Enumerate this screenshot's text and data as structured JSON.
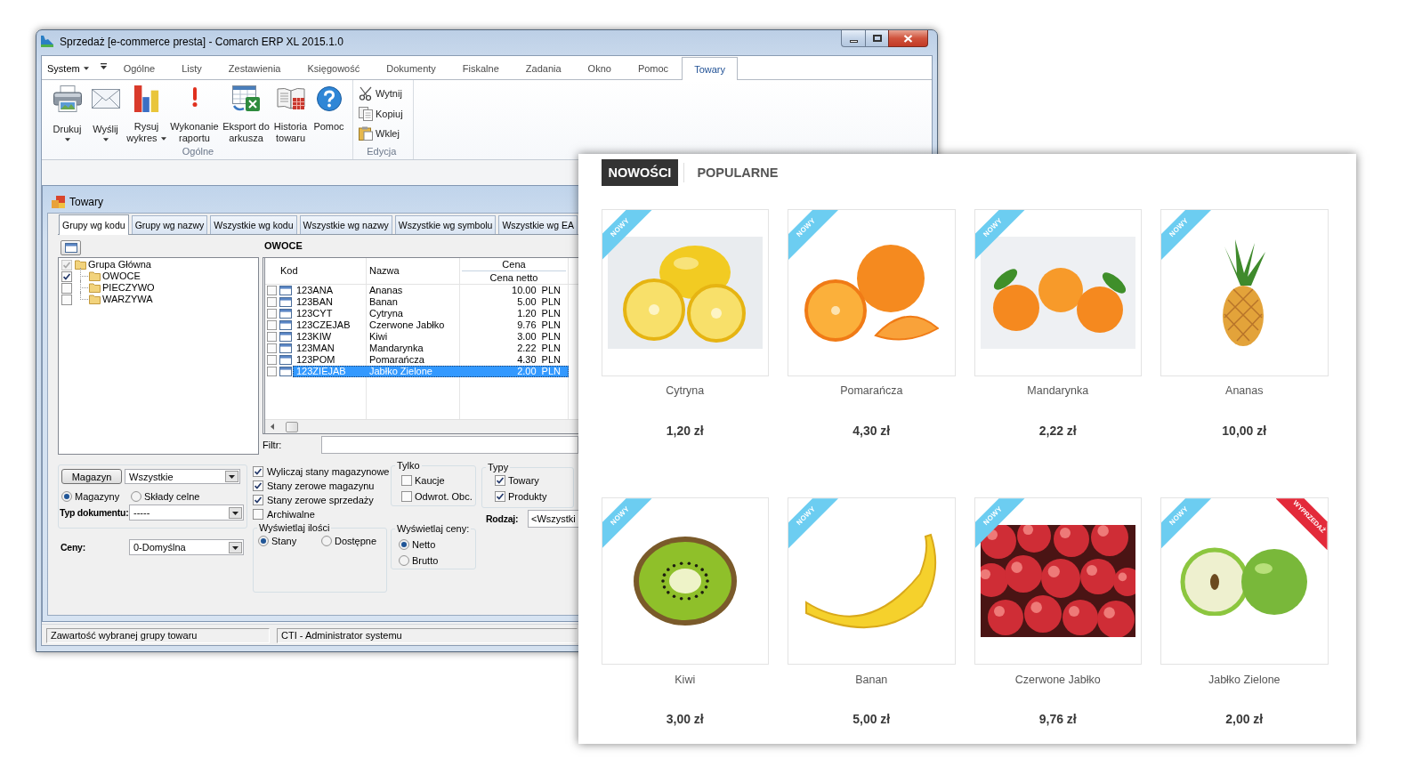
{
  "erp_window": {
    "title": "Sprzedaż [e-commerce presta] - Comarch ERP XL 2015.1.0",
    "menu": {
      "system": "System",
      "tabs": [
        {
          "label": "Ogólne",
          "selected": false
        },
        {
          "label": "Listy",
          "selected": false
        },
        {
          "label": "Zestawienia",
          "selected": false
        },
        {
          "label": "Księgowość",
          "selected": false
        },
        {
          "label": "Dokumenty",
          "selected": false
        },
        {
          "label": "Fiskalne",
          "selected": false
        },
        {
          "label": "Zadania",
          "selected": false
        },
        {
          "label": "Okno",
          "selected": false
        },
        {
          "label": "Pomoc",
          "selected": false
        },
        {
          "label": "Towary",
          "selected": true
        }
      ]
    },
    "ribbon": {
      "groups": [
        {
          "label": "Ogólne",
          "kind": "large",
          "buttons": [
            {
              "label": "Drukuj",
              "kind": "split"
            },
            {
              "label": "Wyślij",
              "kind": "split"
            },
            {
              "label": "Rysuj wykres",
              "kind": "menu"
            },
            {
              "label": "Wykonanie raportu",
              "kind": "plain"
            },
            {
              "label": "Eksport do arkusza",
              "kind": "plain"
            },
            {
              "label": "Historia towaru",
              "kind": "plain"
            },
            {
              "label": "Pomoc",
              "kind": "plain"
            }
          ]
        },
        {
          "label": "Edycja",
          "kind": "small",
          "buttons": [
            {
              "label": "Wytnij"
            },
            {
              "label": "Kopiuj"
            },
            {
              "label": "Wklej"
            }
          ]
        }
      ]
    },
    "child_window": {
      "title": "Towary",
      "tabs": [
        {
          "label": "Grupy wg kodu",
          "selected": true
        },
        {
          "label": "Grupy wg nazwy",
          "selected": false
        },
        {
          "label": "Wszystkie wg kodu",
          "selected": false
        },
        {
          "label": "Wszystkie wg nazwy",
          "selected": false
        },
        {
          "label": "Wszystkie wg symbolu",
          "selected": false
        },
        {
          "label": "Wszystkie wg EA",
          "selected": false
        }
      ],
      "tree": [
        {
          "label": "Grupa Główna",
          "checked": true,
          "disabled": true,
          "children": [
            {
              "label": "OWOCE",
              "checked": true,
              "disabled": false
            },
            {
              "label": "PIECZYWO",
              "checked": false,
              "disabled": false
            },
            {
              "label": "WARZYWA",
              "checked": false,
              "disabled": false
            }
          ]
        }
      ],
      "group_title": "OWOCE",
      "table": {
        "columns": [
          {
            "label": "Kod"
          },
          {
            "label": "Nazwa"
          },
          {
            "label": "Cena",
            "sublabel": "Cena netto"
          }
        ],
        "rows": [
          {
            "cells": [
              "123ANA",
              "Ananas",
              "10.00 PLN"
            ],
            "checked": false,
            "selected": false
          },
          {
            "cells": [
              "123BAN",
              "Banan",
              "5.00 PLN"
            ],
            "checked": false,
            "selected": false
          },
          {
            "cells": [
              "123CYT",
              "Cytryna",
              "1.20 PLN"
            ],
            "checked": false,
            "selected": false
          },
          {
            "cells": [
              "123CZEJAB",
              "Czerwone Jabłko",
              "9.76 PLN"
            ],
            "checked": false,
            "selected": false
          },
          {
            "cells": [
              "123KIW",
              "Kiwi",
              "3.00 PLN"
            ],
            "checked": false,
            "selected": false
          },
          {
            "cells": [
              "123MAN",
              "Mandarynka",
              "2.22 PLN"
            ],
            "checked": false,
            "selected": false
          },
          {
            "cells": [
              "123POM",
              "Pomarańcza",
              "4.30 PLN"
            ],
            "checked": false,
            "selected": false
          },
          {
            "cells": [
              "123ZIEJAB",
              "Jabłko Zielone",
              "2.00 PLN"
            ],
            "checked": false,
            "selected": true
          }
        ]
      },
      "filter": {
        "label": "Filtr:"
      },
      "options": {
        "magazyn": {
          "button": "Magazyn",
          "value": "Wszystkie"
        },
        "source": [
          {
            "label": "Magazyny",
            "selected": true
          },
          {
            "label": "Składy celne",
            "selected": false
          }
        ],
        "document_type": {
          "label": "Typ dokumentu:",
          "value": "-----"
        },
        "prices": {
          "label": "Ceny:",
          "value": "0-Domyślna"
        },
        "checks": [
          {
            "label": "Wyliczaj stany magazynowe",
            "checked": true
          },
          {
            "label": "Stany zerowe magazynu",
            "checked": true
          },
          {
            "label": "Stany zerowe sprzedaży",
            "checked": true
          },
          {
            "label": "Archiwalne",
            "checked": false
          }
        ],
        "quantities": {
          "title": "Wyświetlaj ilości",
          "options": [
            {
              "label": "Stany",
              "selected": true
            },
            {
              "label": "Dostępne",
              "selected": false
            }
          ]
        },
        "only": {
          "title": "Tylko",
          "options": [
            {
              "label": "Kaucje",
              "checked": false
            },
            {
              "label": "Odwrot. Obc.",
              "checked": false
            }
          ]
        },
        "price_display": {
          "title": "Wyświetlaj ceny:",
          "options": [
            {
              "label": "Netto",
              "selected": true
            },
            {
              "label": "Brutto",
              "selected": false
            }
          ]
        },
        "types": {
          "title": "Typy",
          "options": [
            {
              "label": "Towary",
              "checked": true
            },
            {
              "label": "Produkty",
              "checked": true
            }
          ]
        },
        "rodzaj": {
          "label": "Rodzaj:",
          "value": "<Wszystki"
        }
      }
    },
    "status_bar": [
      "Zawartość wybranej grupy towaru",
      "CTI - Administrator systemu"
    ]
  },
  "shop": {
    "tabs": [
      {
        "label": "NOWOŚCI",
        "selected": true
      },
      {
        "label": "POPULARNE",
        "selected": false
      }
    ],
    "products": [
      {
        "name": "Cytryna",
        "price": "1,20 zł",
        "ribbons": [
          {
            "kind": "new",
            "label": "NOWY"
          }
        ]
      },
      {
        "name": "Pomarańcza",
        "price": "4,30 zł",
        "ribbons": [
          {
            "kind": "new",
            "label": "NOWY"
          }
        ]
      },
      {
        "name": "Mandarynka",
        "price": "2,22 zł",
        "ribbons": [
          {
            "kind": "new",
            "label": "NOWY"
          }
        ]
      },
      {
        "name": "Ananas",
        "price": "10,00 zł",
        "ribbons": [
          {
            "kind": "new",
            "label": "NOWY"
          }
        ]
      },
      {
        "name": "Kiwi",
        "price": "3,00 zł",
        "ribbons": [
          {
            "kind": "new",
            "label": "NOWY"
          }
        ]
      },
      {
        "name": "Banan",
        "price": "5,00 zł",
        "ribbons": [
          {
            "kind": "new",
            "label": "NOWY"
          }
        ]
      },
      {
        "name": "Czerwone Jabłko",
        "price": "9,76 zł",
        "ribbons": [
          {
            "kind": "new",
            "label": "NOWY"
          }
        ]
      },
      {
        "name": "Jabłko Zielone",
        "price": "2,00 zł",
        "ribbons": [
          {
            "kind": "new",
            "label": "NOWY"
          },
          {
            "kind": "sale",
            "label": "WYPRZEDAŻ"
          }
        ]
      }
    ]
  }
}
